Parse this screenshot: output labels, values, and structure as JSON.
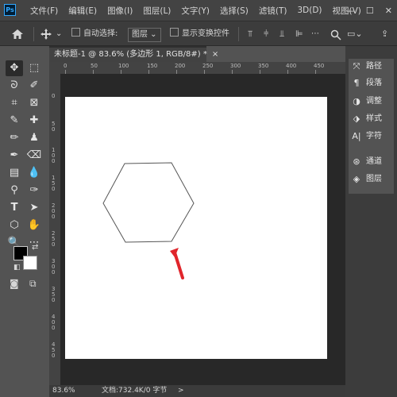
{
  "app": {
    "logo": "Ps"
  },
  "menu": [
    "文件(F)",
    "编辑(E)",
    "图像(I)",
    "图层(L)",
    "文字(Y)",
    "选择(S)",
    "滤镜(T)",
    "3D(D)",
    "视图(V)"
  ],
  "window_controls": {
    "minimize": "—",
    "restore": "☐",
    "close": "✕"
  },
  "options_bar": {
    "home_icon": "home-icon",
    "move_icon": "move-icon",
    "auto_select_label": "自动选择:",
    "auto_select_value": "图层",
    "show_transform_label": "显示变换控件",
    "align_icons": [
      "align-top",
      "align-vcenter",
      "align-bottom",
      "align-left"
    ],
    "search_icon": "search-icon"
  },
  "document": {
    "tab_title": "未标题-1 @ 83.6% (多边形 1, RGB/8#) *",
    "close_label": "×"
  },
  "rulers": {
    "top": [
      "0",
      "50",
      "100",
      "150",
      "200",
      "250",
      "300",
      "350",
      "400",
      "450"
    ],
    "left": [
      "0",
      "5\n0",
      "1\n0\n0",
      "1\n5\n0",
      "2\n0\n0",
      "2\n5\n0",
      "3\n0\n0",
      "3\n5\n0",
      "4\n0\n0",
      "4\n5\n0"
    ]
  },
  "status_bar": {
    "zoom": "83.6%",
    "doc_info": "文档:732.4K/0 字节",
    "arrow": ">"
  },
  "tools": [
    "move-tool",
    "marquee-tool",
    "lasso-tool",
    "quick-select-tool",
    "crop-tool",
    "frame-tool",
    "eyedropper-tool",
    "healing-brush-tool",
    "brush-tool",
    "clone-stamp-tool",
    "history-brush-tool",
    "eraser-tool",
    "gradient-tool",
    "blur-tool",
    "dodge-tool",
    "pen-tool",
    "type-tool",
    "path-select-tool",
    "shape-tool",
    "hand-tool",
    "zoom-tool",
    "more-tools"
  ],
  "colors": {
    "foreground": "#000000",
    "background": "#ffffff",
    "accent": "#e0252b"
  },
  "panels": [
    {
      "icon": "paths-icon",
      "label": "路径"
    },
    {
      "icon": "paragraph-icon",
      "label": "段落"
    },
    {
      "icon": "adjustments-icon",
      "label": "调整"
    },
    {
      "icon": "styles-icon",
      "label": "样式"
    },
    {
      "icon": "character-icon",
      "label": "字符"
    },
    {
      "icon": "channels-icon",
      "label": "通道"
    },
    {
      "icon": "layers-icon",
      "label": "图层"
    }
  ]
}
